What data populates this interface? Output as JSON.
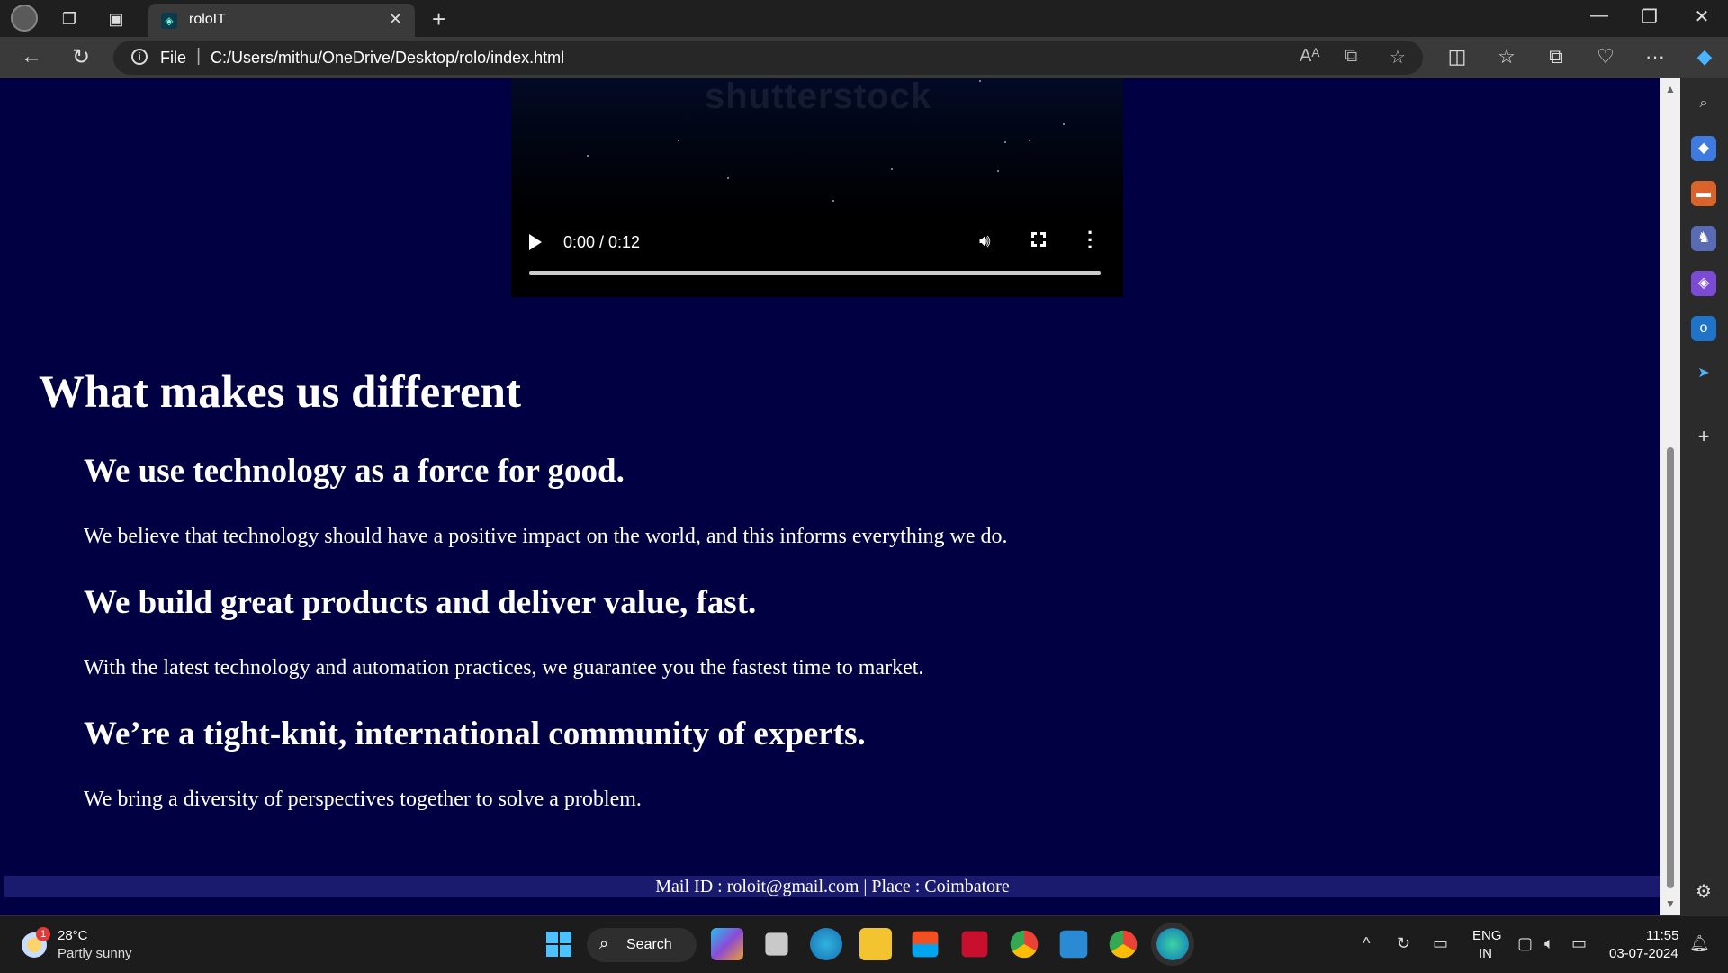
{
  "browser": {
    "tab_title": "roloIT",
    "url_scheme": "File",
    "url": "C:/Users/mithu/OneDrive/Desktop/rolo/index.html"
  },
  "video": {
    "watermark": "shutterstock",
    "time": "0:00 / 0:12",
    "progress": 0
  },
  "page": {
    "section_title": "What makes us different",
    "features": [
      {
        "heading": "We use technology as a force for good.",
        "text": "We believe that technology should have a positive impact on the world, and this informs everything we do."
      },
      {
        "heading": "We build great products and deliver value, fast.",
        "text": "With the latest technology and automation practices, we guarantee you the fastest time to market."
      },
      {
        "heading": "We’re a tight-knit, international community of experts.",
        "text": "We bring a diversity of perspectives together to solve a problem."
      }
    ],
    "footer": "Mail ID : roloit@gmail.com | Place : Coimbatore"
  },
  "taskbar": {
    "weather_temp": "28°C",
    "weather_desc": "Partly sunny",
    "weather_badge": "1",
    "search_label": "Search",
    "lang_top": "ENG",
    "lang_bottom": "IN",
    "time": "11:55",
    "date": "03-07-2024"
  },
  "colors": {
    "page_background": "#000042",
    "footer_background": "#1a1a6e",
    "browser_chrome": "#1f1f1f"
  }
}
